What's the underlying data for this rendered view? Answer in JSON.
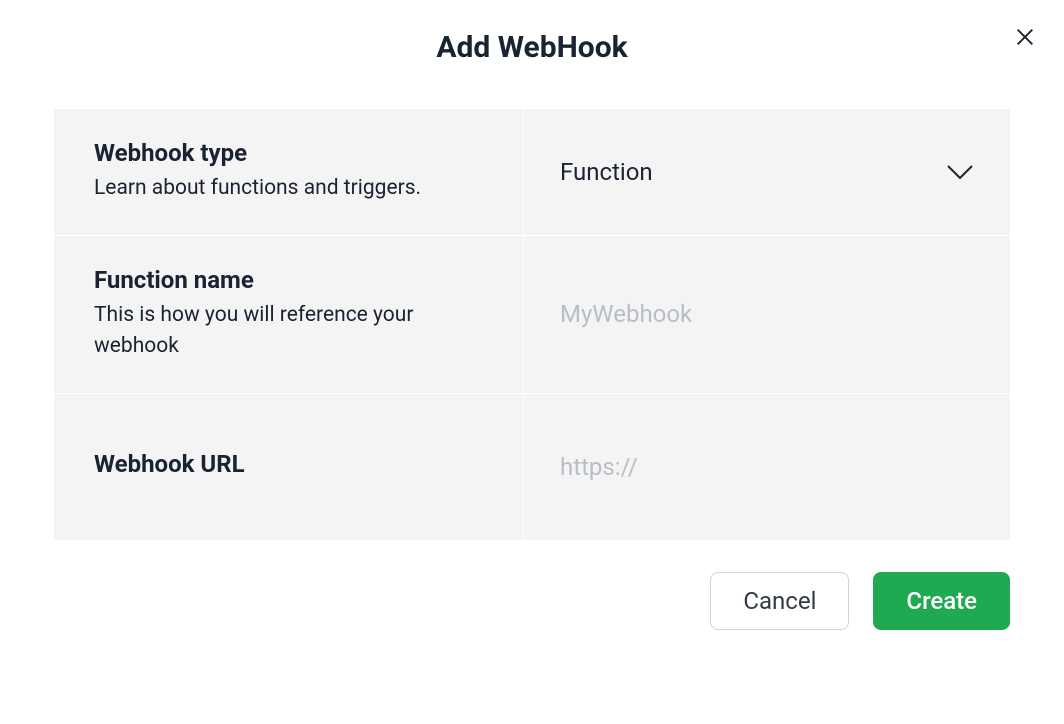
{
  "modal": {
    "title": "Add WebHook",
    "rows": {
      "webhook_type": {
        "label": "Webhook type",
        "description": "Learn about functions and triggers.",
        "selected": "Function"
      },
      "function_name": {
        "label": "Function name",
        "description": "This is how you will reference your webhook",
        "placeholder": "MyWebhook",
        "value": ""
      },
      "webhook_url": {
        "label": "Webhook URL",
        "placeholder": "https://",
        "value": ""
      }
    },
    "actions": {
      "cancel": "Cancel",
      "create": "Create"
    }
  }
}
